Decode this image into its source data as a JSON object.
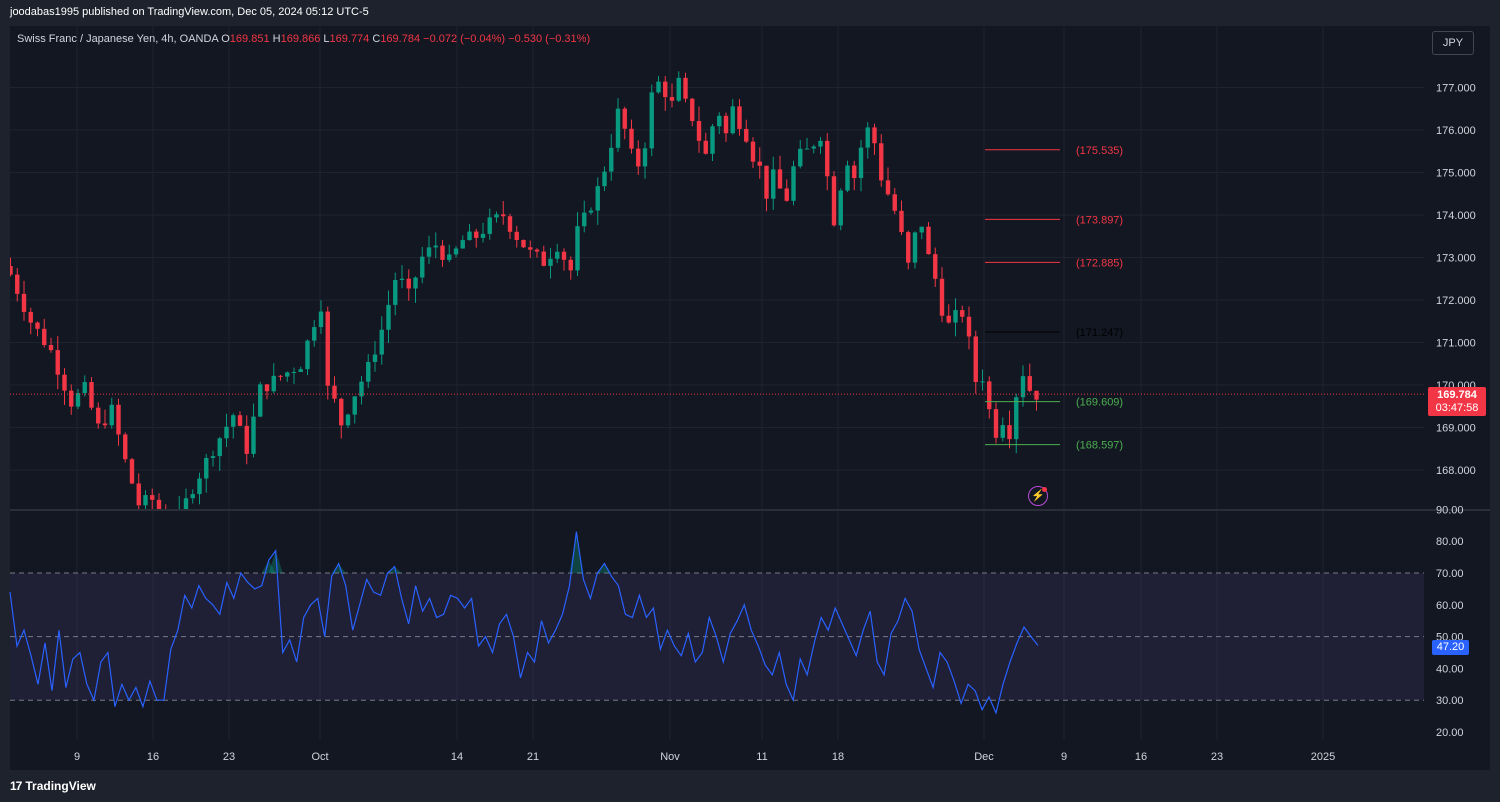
{
  "header": {
    "published": "joodabas1995 published on TradingView.com, Dec 05, 2024 05:12 UTC-5"
  },
  "legend": {
    "symbol": "Swiss Franc / Japanese Yen, 4h, OANDA",
    "o_label": "O",
    "o": "169.851",
    "h_label": "H",
    "h": "169.866",
    "l_label": "L",
    "l": "169.774",
    "c_label": "C",
    "c": "169.784",
    "change": "−0.072 (−0.04%)",
    "change2": "−0.530 (−0.31%)"
  },
  "currency_button": "JPY",
  "price_badge": {
    "price": "169.784",
    "countdown": "03:47:58"
  },
  "rsi_badge": "47.20",
  "footer": {
    "logo_mark": "17",
    "brand": "TradingView"
  },
  "colors": {
    "up": "#089981",
    "down": "#f23645",
    "rsi": "#2962ff",
    "background": "#131722"
  },
  "chart_data": [
    {
      "type": "candlestick",
      "ylim": [
        167.1,
        178.0
      ],
      "yticks": [
        "177.000",
        "176.000",
        "175.000",
        "174.000",
        "173.000",
        "172.000",
        "171.000",
        "170.000",
        "169.000",
        "168.000"
      ],
      "x_ticks": [
        "9",
        "16",
        "23",
        "Oct",
        "14",
        "21",
        "Nov",
        "11",
        "18",
        "Dec",
        "9",
        "16",
        "23",
        "2025"
      ],
      "last_price": 169.784,
      "close_path": [
        [
          0,
          172.6
        ],
        [
          3,
          171.5
        ],
        [
          6,
          170.8
        ],
        [
          9,
          169.6
        ],
        [
          11,
          169.9
        ],
        [
          13,
          169.0
        ],
        [
          15,
          169.4
        ],
        [
          17,
          168.2
        ],
        [
          19,
          167.2
        ],
        [
          21,
          167.3
        ],
        [
          23,
          166.6
        ],
        [
          25,
          166.9
        ],
        [
          27,
          167.6
        ],
        [
          30,
          168.5
        ],
        [
          33,
          169.3
        ],
        [
          35,
          168.5
        ],
        [
          37,
          169.9
        ],
        [
          40,
          170.2
        ],
        [
          43,
          170.5
        ],
        [
          45,
          171.5
        ],
        [
          46,
          171.9
        ],
        [
          47,
          169.9
        ],
        [
          48,
          169.6
        ],
        [
          49,
          169.1
        ],
        [
          51,
          169.8
        ],
        [
          53,
          170.4
        ],
        [
          55,
          171.3
        ],
        [
          57,
          172.5
        ],
        [
          58,
          172.4
        ],
        [
          59,
          172.1
        ],
        [
          61,
          173.0
        ],
        [
          63,
          173.3
        ],
        [
          65,
          172.9
        ],
        [
          67,
          173.4
        ],
        [
          69,
          173.5
        ],
        [
          71,
          173.8
        ],
        [
          73,
          174.0
        ],
        [
          75,
          173.5
        ],
        [
          77,
          173.1
        ],
        [
          79,
          172.9
        ],
        [
          81,
          173.3
        ],
        [
          83,
          172.7
        ],
        [
          84,
          173.6
        ],
        [
          85,
          173.9
        ],
        [
          87,
          174.6
        ],
        [
          88,
          175.1
        ],
        [
          89,
          175.7
        ],
        [
          90,
          176.4
        ],
        [
          91,
          176.0
        ],
        [
          92,
          175.4
        ],
        [
          93,
          175.2
        ],
        [
          94,
          175.7
        ],
        [
          95,
          176.8
        ],
        [
          96,
          177.1
        ],
        [
          97,
          176.9
        ],
        [
          98,
          176.6
        ],
        [
          99,
          177.1
        ],
        [
          100,
          176.6
        ],
        [
          101,
          176.3
        ],
        [
          102,
          175.8
        ],
        [
          103,
          175.4
        ],
        [
          104,
          176.1
        ],
        [
          105,
          176.4
        ],
        [
          106,
          175.9
        ],
        [
          107,
          176.5
        ],
        [
          108,
          176.2
        ],
        [
          109,
          175.9
        ],
        [
          110,
          175.4
        ],
        [
          111,
          175.1
        ],
        [
          112,
          174.5
        ],
        [
          113,
          174.9
        ],
        [
          114,
          174.6
        ],
        [
          115,
          174.4
        ],
        [
          116,
          175.1
        ],
        [
          117,
          175.4
        ],
        [
          118,
          175.5
        ],
        [
          119,
          175.7
        ],
        [
          120,
          175.9
        ],
        [
          121,
          174.9
        ],
        [
          122,
          173.9
        ],
        [
          123,
          174.7
        ],
        [
          124,
          175.3
        ],
        [
          125,
          174.9
        ],
        [
          126,
          175.6
        ],
        [
          127,
          176.0
        ],
        [
          128,
          175.7
        ],
        [
          129,
          174.9
        ],
        [
          130,
          174.5
        ],
        [
          131,
          174.1
        ],
        [
          132,
          173.5
        ],
        [
          133,
          172.8
        ],
        [
          134,
          173.5
        ],
        [
          135,
          173.8
        ],
        [
          136,
          173.0
        ],
        [
          137,
          172.5
        ],
        [
          138,
          171.8
        ],
        [
          139,
          171.4
        ],
        [
          140,
          171.6
        ],
        [
          141,
          171.7
        ],
        [
          142,
          171.0
        ],
        [
          143,
          170.1
        ],
        [
          144,
          170.2
        ],
        [
          145,
          169.4
        ],
        [
          146,
          168.9
        ],
        [
          147,
          169.2
        ],
        [
          148,
          168.9
        ],
        [
          149,
          169.8
        ],
        [
          150,
          170.3
        ],
        [
          151,
          169.9
        ],
        [
          152,
          169.784
        ]
      ],
      "horizontal_levels": [
        {
          "value": 175.535,
          "label": "(175.535)",
          "color": "#f23645"
        },
        {
          "value": 173.897,
          "label": "(173.897)",
          "color": "#f23645"
        },
        {
          "value": 172.885,
          "label": "(172.885)",
          "color": "#f23645"
        },
        {
          "value": 171.247,
          "label": "(171.247)",
          "color": "#000000"
        },
        {
          "value": 169.609,
          "label": "(169.609)",
          "color": "#4caf50"
        },
        {
          "value": 168.597,
          "label": "(168.597)",
          "color": "#4caf50"
        }
      ]
    },
    {
      "type": "line",
      "series": [
        {
          "values": [
            64,
            47,
            52,
            44,
            35,
            48,
            33,
            52,
            34,
            43,
            45,
            35,
            30,
            42,
            45,
            28,
            35,
            30,
            34,
            28,
            36,
            30,
            30,
            46,
            52,
            63,
            59,
            66,
            62,
            60,
            57,
            67,
            62,
            70,
            67,
            65,
            66,
            74,
            77,
            45,
            49,
            42,
            56,
            60,
            62,
            50,
            69,
            73,
            66,
            52,
            60,
            68,
            64,
            63,
            70,
            72,
            62,
            54,
            66,
            58,
            62,
            56,
            57,
            63,
            62,
            59,
            62,
            47,
            50,
            45,
            54,
            57,
            50,
            37,
            45,
            42,
            55,
            48,
            52,
            57,
            66,
            83,
            68,
            62,
            70,
            73,
            69,
            66,
            57,
            56,
            63,
            56,
            59,
            46,
            52,
            47,
            44,
            51,
            42,
            45,
            56,
            50,
            42,
            51,
            55,
            60,
            52,
            47,
            41,
            38,
            45,
            35,
            30,
            43,
            38,
            48,
            56,
            52,
            59,
            54,
            49,
            44,
            52,
            58,
            42,
            38,
            51,
            55,
            62,
            58,
            46,
            40,
            34,
            45,
            42,
            36,
            29,
            35,
            33,
            27,
            31,
            26,
            35,
            42,
            48,
            53,
            50,
            47.2
          ]
        }
      ],
      "ylim": [
        17,
        90
      ],
      "yticks": [
        "90.00",
        "80.00",
        "70.00",
        "60.00",
        "50.00",
        "40.00",
        "30.00",
        "20.00"
      ],
      "band": [
        30,
        70
      ],
      "midline": 50,
      "last_value": 47.2
    }
  ]
}
